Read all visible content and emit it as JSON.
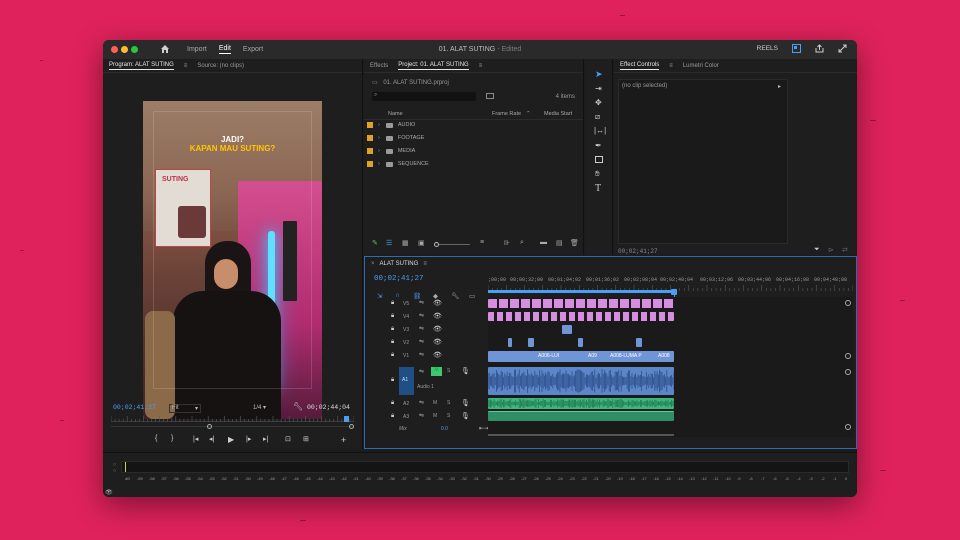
{
  "titlebar": {
    "nav": [
      "Import",
      "Edit",
      "Export"
    ],
    "active_nav": "Edit",
    "project_title": "01. ALAT SUTING",
    "edited_suffix": "- Edited",
    "reels_label": "REELS"
  },
  "program_monitor": {
    "tab_program": "Program: ALAT SUTING",
    "tab_source": "Source: (no clips)",
    "overlay_line1": "JADI?",
    "overlay_line2": "KAPAN MAU SUTING?",
    "poster_text": "SUTING",
    "current_time": "00;02;41;27",
    "fit": "Fit",
    "resolution": "1/4",
    "duration": "00;02;44;04"
  },
  "project_panel": {
    "tab_effects": "Effects",
    "tab_project": "Project: 01. ALAT SUTING",
    "file_name": "01. ALAT SUTING.prproj",
    "items_count": "4 items",
    "col_name": "Name",
    "col_frame_rate": "Frame Rate",
    "col_media_start": "Media Start",
    "items": [
      "AUDIO",
      "FOOTAGE",
      "MEDIA",
      "SEQUENCE"
    ]
  },
  "effect_controls": {
    "tab_effect_controls": "Effect Controls",
    "tab_lumetri": "Lumetri Color",
    "no_clip": "(no clip selected)",
    "time": "00;02;41;27"
  },
  "timeline": {
    "sequence_tab": "ALAT SUTING",
    "timecode": "00;02;41;27",
    "ruler": [
      ";00;00",
      "00;00;32;00",
      "00;01;04;02",
      "00;01;36;02",
      "00;02;08;04",
      "00;02;40;04",
      "00;03;12;06",
      "00;03;44;06",
      "00;04;16;08",
      "00;04;48;08"
    ],
    "video_tracks": [
      "V5",
      "V4",
      "V3",
      "V2",
      "V1"
    ],
    "audio_tracks": [
      "A1",
      "A2",
      "A3"
    ],
    "audio1_name": "Audio 1",
    "mix_label": "Mix",
    "mix_value": "0.0",
    "v1_clip_labels": [
      "A006-LUI",
      "A09",
      "A008-LUMA P",
      "A008"
    ]
  },
  "audio_meter": {
    "scale": [
      "dB",
      "-59",
      "-58",
      "-57",
      "-56",
      "-55",
      "-54",
      "-53",
      "-52",
      "-51",
      "-50",
      "-49",
      "-48",
      "-47",
      "-46",
      "-45",
      "-44",
      "-43",
      "-42",
      "-41",
      "-40",
      "-39",
      "-38",
      "-37",
      "-36",
      "-35",
      "-34",
      "-33",
      "-32",
      "-31",
      "-30",
      "-29",
      "-28",
      "-27",
      "-26",
      "-25",
      "-24",
      "-23",
      "-22",
      "-21",
      "-20",
      "-19",
      "-18",
      "-17",
      "-16",
      "-15",
      "-14",
      "-13",
      "-12",
      "-11",
      "-10",
      "-9",
      "-8",
      "-7",
      "-6",
      "-5",
      "-4",
      "-3",
      "-2",
      "-1",
      "0"
    ]
  },
  "colors": {
    "background": "#e0225c",
    "accent": "#4a9ff5",
    "video_clip": "#6f95d6",
    "pink_clip": "#d78de0",
    "audio_clip": "#5b86c9",
    "audio2_clip": "#3fb67f"
  }
}
